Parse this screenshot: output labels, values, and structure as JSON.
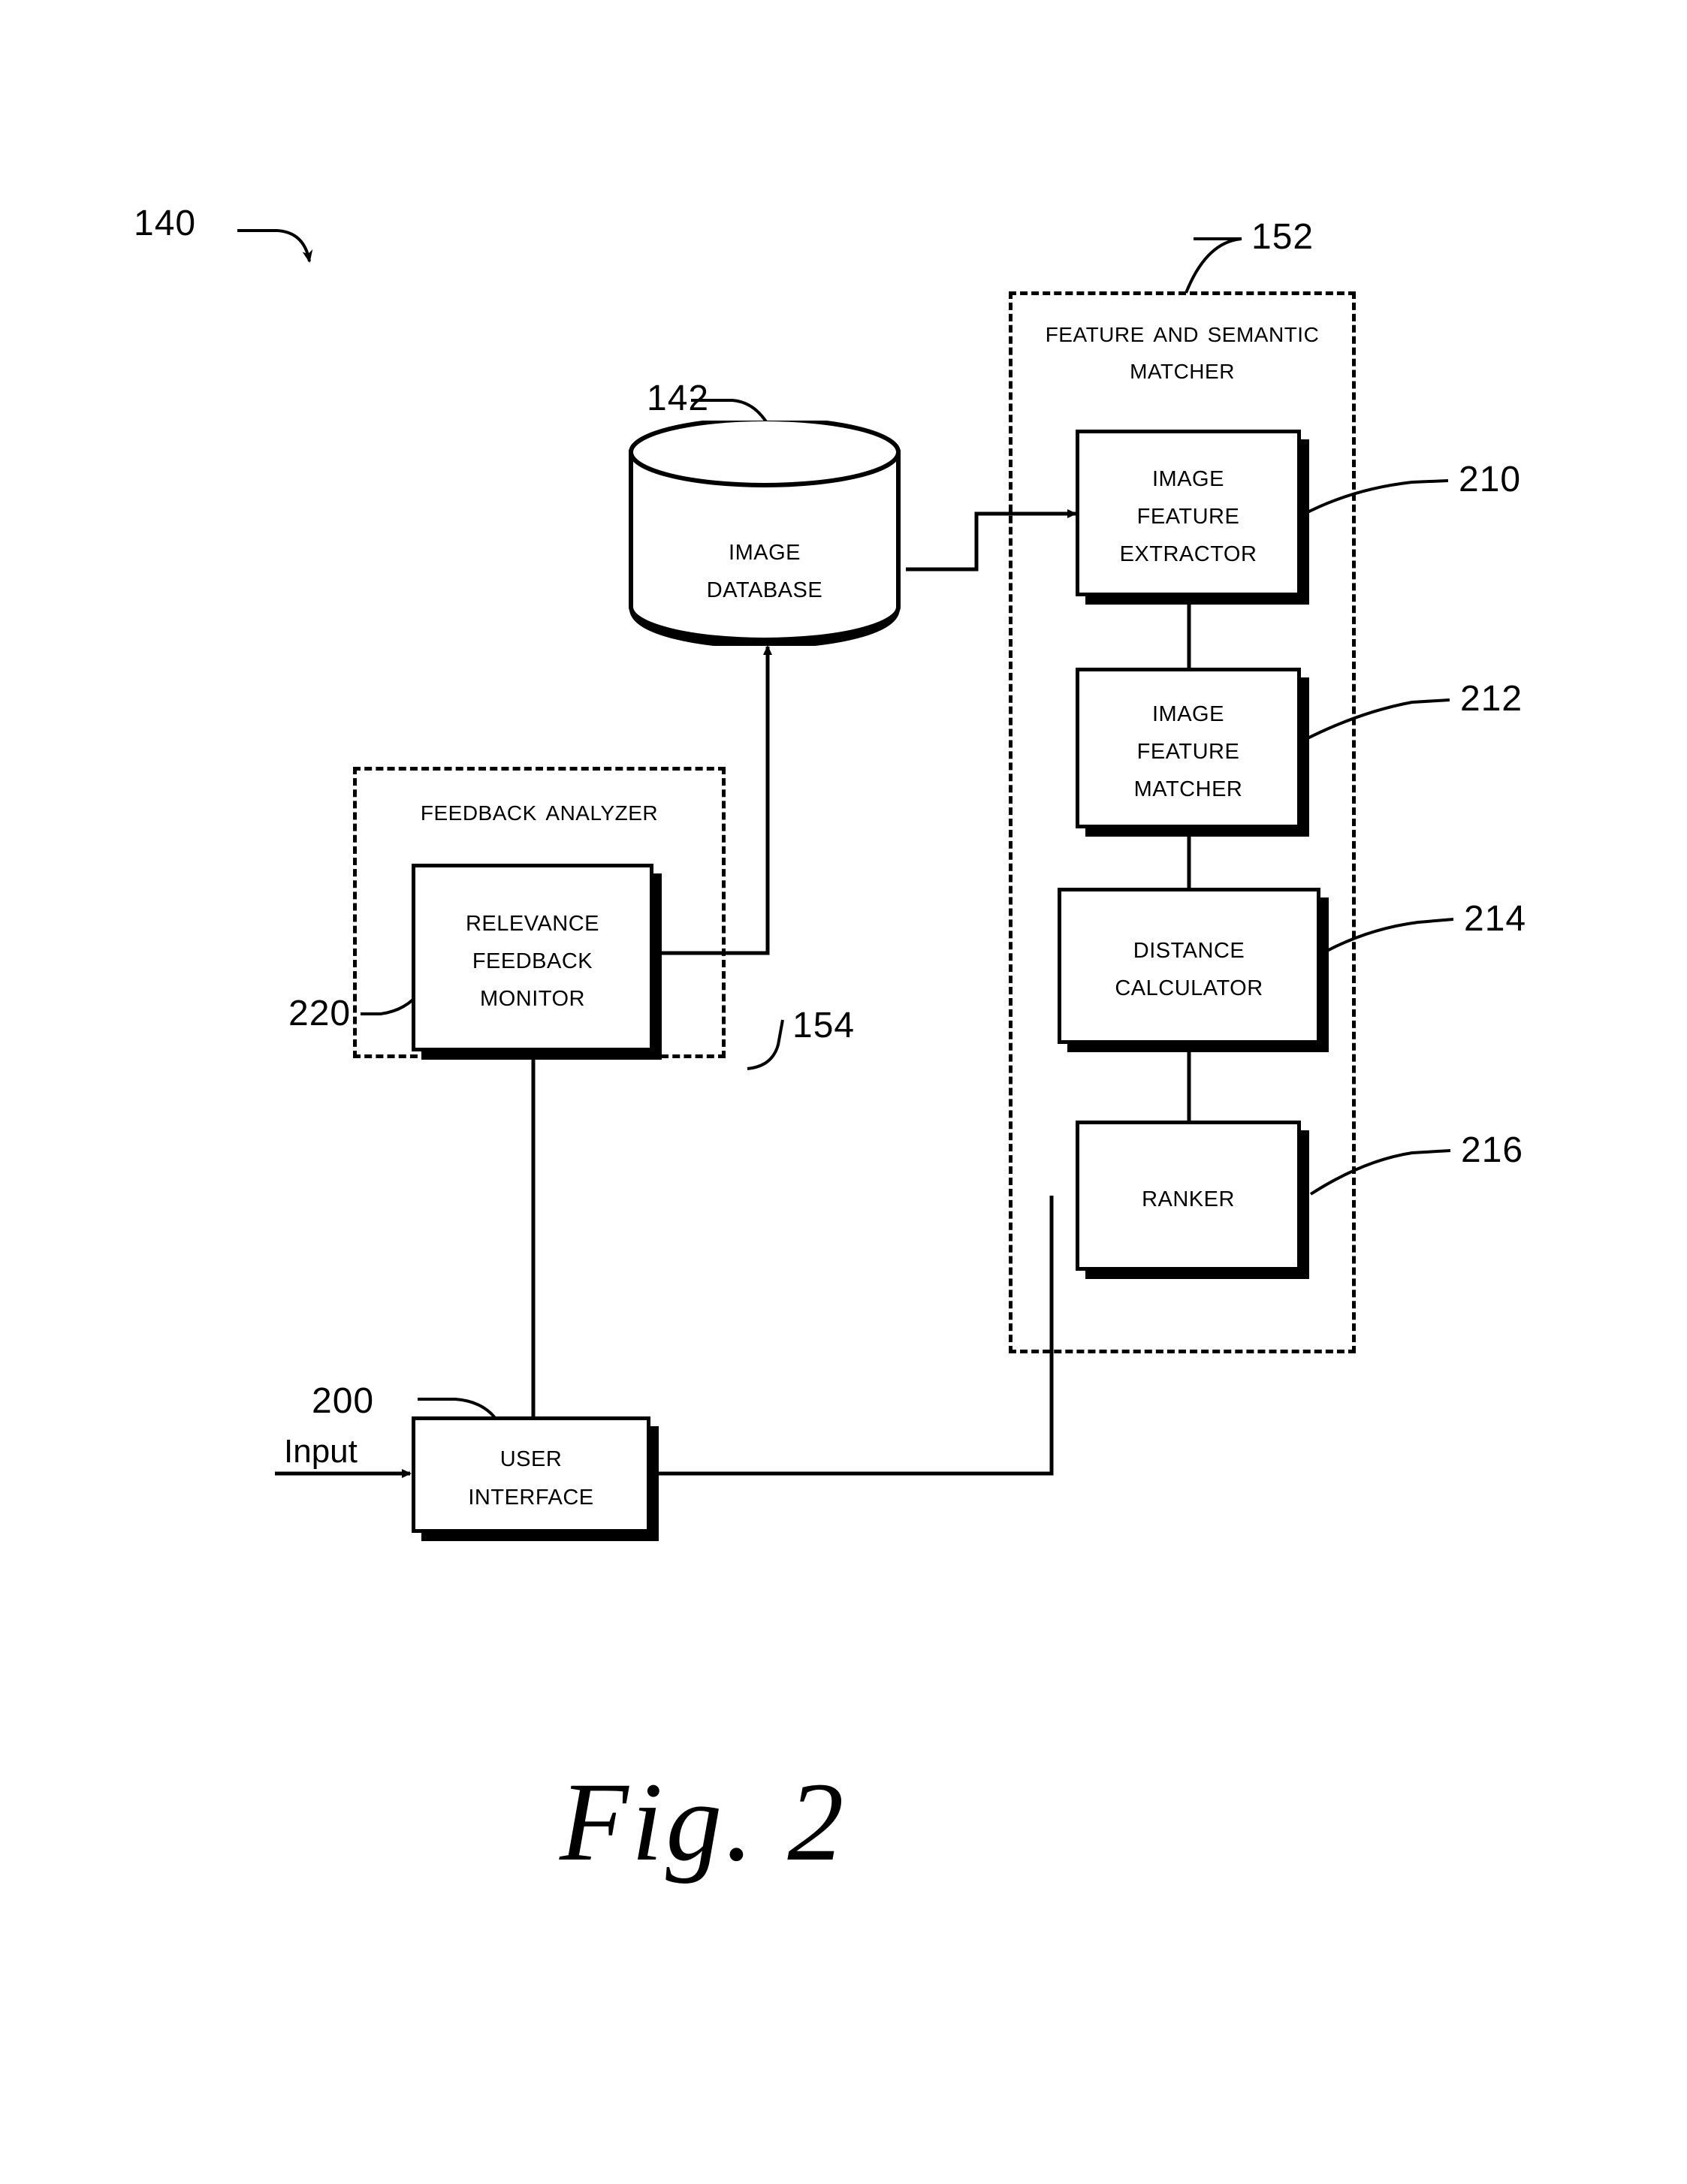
{
  "figure": {
    "caption": "Fig. 2",
    "system_ref": "140"
  },
  "groups": [
    {
      "id": "feature-and-semantic-matcher",
      "title": "Feature and Semantic\nMatcher",
      "ref": "152"
    },
    {
      "id": "feedback-analyzer",
      "title": "Feedback Analyzer",
      "ref": "154"
    }
  ],
  "nodes": [
    {
      "id": "image-database",
      "label": "Image\nDatabase",
      "ref": "142"
    },
    {
      "id": "image-feature-extractor",
      "label": "Image\nFeature\nExtractor",
      "ref": "210"
    },
    {
      "id": "image-feature-matcher",
      "label": "Image\nFeature\nMatcher",
      "ref": "212"
    },
    {
      "id": "distance-calculator",
      "label": "Distance\nCalculator",
      "ref": "214"
    },
    {
      "id": "ranker",
      "label": "Ranker",
      "ref": "216"
    },
    {
      "id": "relevance-feedback-monitor",
      "label": "Relevance\nFeedback\nMonitor",
      "ref": "220"
    },
    {
      "id": "user-interface",
      "label": "User\nInterface",
      "ref": "200"
    }
  ],
  "labels": {
    "input": "Input"
  },
  "colors": {
    "ink": "#000000",
    "paper": "#ffffff"
  }
}
